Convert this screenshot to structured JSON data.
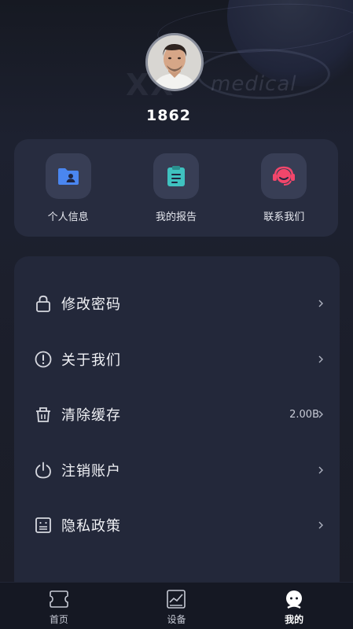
{
  "profile": {
    "username": "1862",
    "avatar_icon": "user-photo"
  },
  "quick_actions": [
    {
      "label": "个人信息",
      "icon": "folder-user-icon",
      "color": "#4a86f0"
    },
    {
      "label": "我的报告",
      "icon": "clipboard-icon",
      "color": "#3fc2c0"
    },
    {
      "label": "联系我们",
      "icon": "headset-icon",
      "color": "#f2466b"
    }
  ],
  "menu": {
    "items": [
      {
        "label": "修改密码",
        "icon": "lock-icon",
        "value": ""
      },
      {
        "label": "关于我们",
        "icon": "info-circle-icon",
        "value": ""
      },
      {
        "label": "清除缓存",
        "icon": "trash-icon",
        "value": "2.00B"
      },
      {
        "label": "注销账户",
        "icon": "power-icon",
        "value": ""
      },
      {
        "label": "隐私政策",
        "icon": "policy-doc-icon",
        "value": ""
      }
    ]
  },
  "tabbar": {
    "tabs": [
      {
        "label": "首页",
        "icon": "home-icon",
        "active": false
      },
      {
        "label": "设备",
        "icon": "chart-device-icon",
        "active": false
      },
      {
        "label": "我的",
        "icon": "profile-icon",
        "active": true
      }
    ]
  },
  "colors": {
    "background": "#1b1e29",
    "card": "#272c3f",
    "menu_card": "#23283a",
    "tabbar": "#151823"
  }
}
